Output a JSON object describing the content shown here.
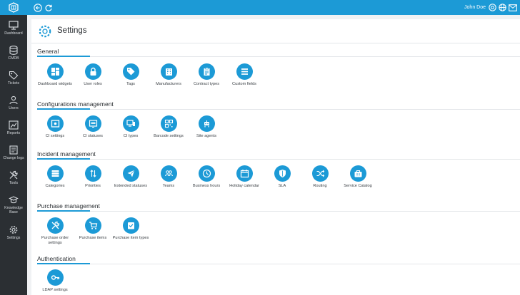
{
  "colors": {
    "brand": "#1c9ad6",
    "sidebar": "#2b2f33",
    "background": "#f0f2f4"
  },
  "topbar": {
    "logo_icon": "app-logo-icon",
    "back_icon": "back-arrow-icon",
    "refresh_icon": "refresh-icon",
    "user_name": "John Doe",
    "right_icons": [
      "help-icon",
      "globe-icon",
      "mail-icon"
    ]
  },
  "sidebar": {
    "items": [
      {
        "label": "Dashboard",
        "icon": "monitor-icon"
      },
      {
        "label": "CMDB",
        "icon": "database-icon"
      },
      {
        "label": "Tickets",
        "icon": "tag-icon"
      },
      {
        "label": "Users",
        "icon": "users-icon"
      },
      {
        "label": "Reports",
        "icon": "chart-icon"
      },
      {
        "label": "Change logs",
        "icon": "change-log-icon"
      },
      {
        "label": "Tools",
        "icon": "tools-icon"
      },
      {
        "label": "Knowledge Base",
        "icon": "knowledge-base-icon"
      },
      {
        "label": "Settings",
        "icon": "gear-icon"
      }
    ]
  },
  "page": {
    "title": "Settings",
    "icon": "gear-icon"
  },
  "sections": [
    {
      "title": "General",
      "items": [
        {
          "label": "Dashboard widgets",
          "icon": "widgets-icon"
        },
        {
          "label": "User roles",
          "icon": "lock-icon"
        },
        {
          "label": "Tags",
          "icon": "tags-icon"
        },
        {
          "label": "Manufacturers",
          "icon": "building-icon"
        },
        {
          "label": "Contract types",
          "icon": "clipboard-icon"
        },
        {
          "label": "Custom fields",
          "icon": "list-icon"
        }
      ]
    },
    {
      "title": "Configurations management",
      "items": [
        {
          "label": "CI settings",
          "icon": "ci-settings-icon"
        },
        {
          "label": "CI statuses",
          "icon": "ci-statuses-icon"
        },
        {
          "label": "CI types",
          "icon": "devices-icon"
        },
        {
          "label": "Barcode settings",
          "icon": "qr-code-icon"
        },
        {
          "label": "Site agents",
          "icon": "robot-icon"
        }
      ]
    },
    {
      "title": "Incident management",
      "items": [
        {
          "label": "Categories",
          "icon": "categories-icon"
        },
        {
          "label": "Priorities",
          "icon": "sort-arrows-icon"
        },
        {
          "label": "Extended statuses",
          "icon": "paper-plane-icon"
        },
        {
          "label": "Teams",
          "icon": "team-icon"
        },
        {
          "label": "Business hours",
          "icon": "clock-icon"
        },
        {
          "label": "Holiday calendar",
          "icon": "calendar-icon"
        },
        {
          "label": "SLA",
          "icon": "shield-icon"
        },
        {
          "label": "Routing",
          "icon": "shuffle-icon"
        },
        {
          "label": "Service Catalog",
          "icon": "briefcase-icon"
        }
      ]
    },
    {
      "title": "Purchase management",
      "items": [
        {
          "label": "Purchase order settings",
          "icon": "wrench-screwdriver-icon"
        },
        {
          "label": "Purchase items",
          "icon": "cart-icon"
        },
        {
          "label": "Purchase item types",
          "icon": "checklist-icon"
        }
      ]
    },
    {
      "title": "Authentication",
      "items": [
        {
          "label": "LDAP settings",
          "icon": "key-icon"
        }
      ]
    }
  ]
}
